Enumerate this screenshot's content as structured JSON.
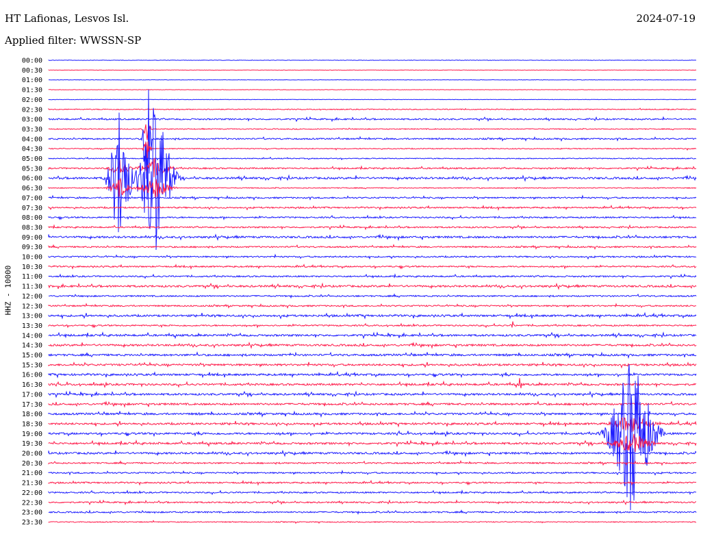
{
  "header": {
    "station": "HT Lafionas, Lesvos Isl.",
    "filter": "Applied filter: WWSSN-SP",
    "date": "2024-07-19"
  },
  "chart_data": {
    "type": "line",
    "title": "HT Lafionas, Lesvos Isl.",
    "subtitle": "Applied filter: WWSSN-SP",
    "ylabel": "HHZ - 10000",
    "rows": [
      "00:00",
      "00:30",
      "01:00",
      "01:30",
      "02:00",
      "02:30",
      "03:00",
      "03:30",
      "04:00",
      "04:30",
      "05:00",
      "05:30",
      "06:00",
      "06:30",
      "07:00",
      "07:30",
      "08:00",
      "08:30",
      "09:00",
      "09:30",
      "10:00",
      "10:30",
      "11:00",
      "11:30",
      "12:00",
      "12:30",
      "13:00",
      "13:30",
      "14:00",
      "14:30",
      "15:00",
      "15:30",
      "16:00",
      "16:30",
      "17:00",
      "17:30",
      "18:00",
      "18:30",
      "19:00",
      "19:30",
      "20:00",
      "20:30",
      "21:00",
      "21:30",
      "22:00",
      "22:30",
      "23:00",
      "23:30"
    ],
    "colors": [
      "#1a1aff",
      "#ff1a4a"
    ],
    "noise_level": [
      0,
      0,
      0,
      0,
      0,
      1,
      2,
      1,
      2,
      1,
      1,
      2,
      3,
      1,
      2,
      2,
      2,
      2,
      3,
      2,
      2,
      2,
      2,
      3,
      2,
      2,
      3,
      2,
      3,
      3,
      3,
      3,
      3,
      3,
      3,
      3,
      3,
      3,
      3,
      3,
      3,
      2,
      2,
      2,
      2,
      2,
      2,
      1
    ],
    "events": [
      {
        "row": 8,
        "x_fraction": 0.152,
        "amplitude": 165,
        "span": 0.01
      },
      {
        "row": 12,
        "x_fraction": 0.11,
        "amplitude": 120,
        "span": 0.03
      },
      {
        "row": 12,
        "x_fraction": 0.165,
        "amplitude": 135,
        "span": 0.045
      },
      {
        "row": 33,
        "x_fraction": 0.728,
        "amplitude": 20,
        "span": 0.004
      },
      {
        "row": 38,
        "x_fraction": 0.901,
        "amplitude": 130,
        "span": 0.06
      },
      {
        "row": 27,
        "x_fraction": 0.716,
        "amplitude": 10,
        "span": 0.004
      }
    ]
  }
}
